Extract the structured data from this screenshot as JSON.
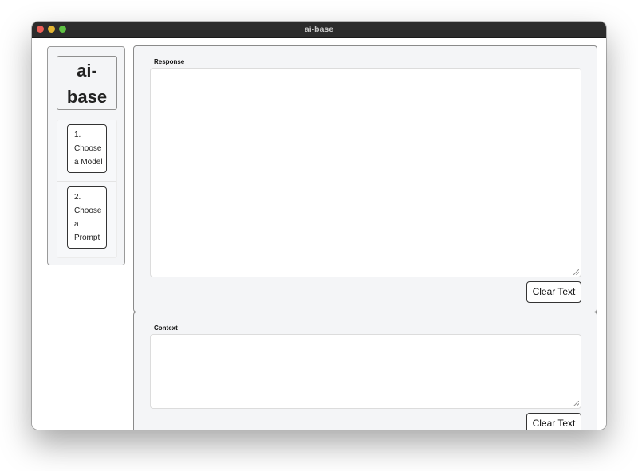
{
  "window": {
    "title": "ai-base"
  },
  "sidebar": {
    "brand_line1": "ai-",
    "brand_line2": "base",
    "steps": [
      {
        "lines": [
          "1.",
          "Choose",
          "a Model"
        ]
      },
      {
        "lines": [
          "2.",
          "Choose",
          "a",
          "Prompt"
        ]
      }
    ]
  },
  "response": {
    "label": "Response",
    "value": "",
    "clear_label": "Clear Text"
  },
  "context": {
    "label": "Context",
    "value": "",
    "clear_label": "Clear Text"
  }
}
